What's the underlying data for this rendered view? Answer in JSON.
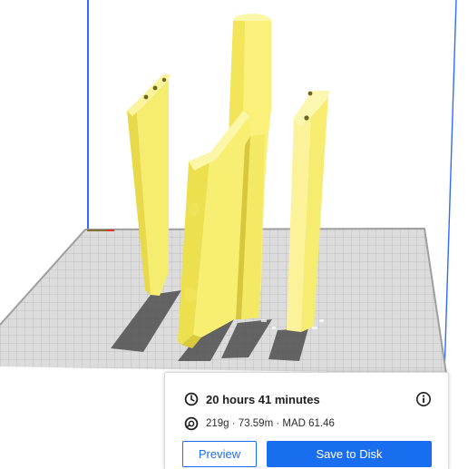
{
  "print_info": {
    "time_label": "20 hours 41 minutes",
    "material_label": "219g · 73.59m · MAD 61.46"
  },
  "actions": {
    "preview_label": "Preview",
    "save_label": "Save to Disk"
  },
  "icons": {
    "time": "clock-icon",
    "material": "filament-spool-icon",
    "info": "info-icon"
  },
  "colors": {
    "model": "#f6ea62",
    "accent": "#196ef0",
    "build_plate": "#dcdcdc",
    "build_volume_edge": "#1e64ff"
  }
}
